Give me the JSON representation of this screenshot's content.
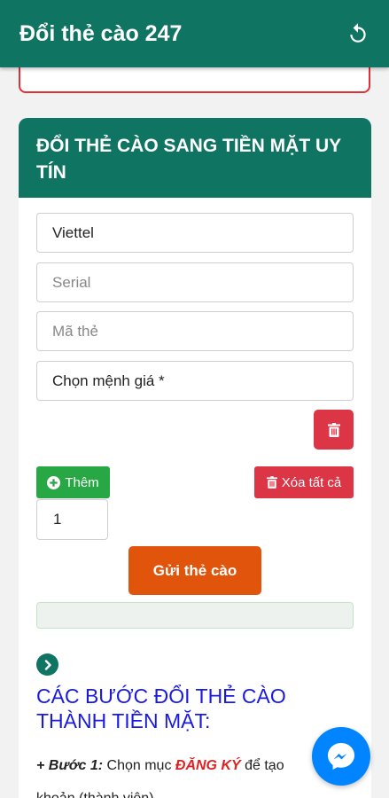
{
  "appbar": {
    "title": "Đổi thẻ cào 247",
    "refresh_icon": "refresh-icon",
    "color": "#107462"
  },
  "card": {
    "title": "ĐỔI THẺ CÀO SANG TIỀN MẶT UY TÍN"
  },
  "form": {
    "telco_value": "Viettel",
    "serial_placeholder": "Serial",
    "code_placeholder": "Mã thẻ",
    "amount_value": "Chọn mệnh giá *",
    "add_label": "Thêm",
    "clear_all_label": "Xóa tất cả",
    "quantity_value": "1",
    "submit_label": "Gửi thẻ cào"
  },
  "guide": {
    "title": "CÁC BƯỚC ĐỔI THẺ CÀO THÀNH TIỀN MẶT:",
    "step1_prefix": "+ Bước 1:",
    "step1_text_a": " Chọn mục ",
    "step1_highlight": "ĐĂNG KÝ",
    "step1_text_b": " để tạo",
    "step1_text_c": "khoản (thành viên)"
  },
  "colors": {
    "danger": "#dc3545",
    "success": "#28a745",
    "submit": "#e0540c",
    "heading_blue": "#1a1adf"
  }
}
